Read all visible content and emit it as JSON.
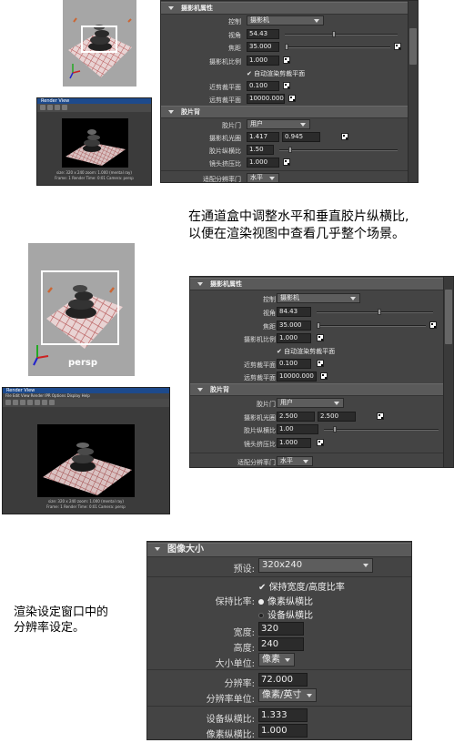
{
  "captions": {
    "caption1_line1": "在通道盒中调整水平和垂直胶片纵横比,",
    "caption1_line2": "以便在渲染视图中查看几乎整个场景。",
    "caption3_line1": "渲染设定窗口中的",
    "caption3_line2": "分辨率设定。"
  },
  "viewport2": {
    "label": "persp"
  },
  "render_view1": {
    "title": "Render View",
    "info_line1": "size: 320 x 240  zoom: 1.000      (mental ray)",
    "info_line2": "Frame: 1    Render Time: 0:01    Camera: persp"
  },
  "render_view2": {
    "title": "Render View",
    "menu": "File  Edit  View  Render  IPR  Options  Display  Help",
    "info_line1": "size: 320 x 240  zoom: 1.000      (mental ray)",
    "info_line2": "Frame: 1      Render Time: 0:01      Camera: persp"
  },
  "panel1": {
    "camera_attrs": {
      "header": "摄影机属性",
      "control_label": "控制",
      "control_value": "摄影机",
      "angle_label": "视角",
      "angle_value": "54.43",
      "angle_ratio": 0.42,
      "focal_label": "焦距",
      "focal_value": "35.000",
      "focal_ratio": 0.0,
      "scale_label": "摄影机比例",
      "scale_value": "1.000",
      "auto_clip_label": "自动渲染剪裁平面",
      "near_label": "近剪裁平面",
      "near_value": "0.100",
      "far_label": "远剪裁平面",
      "far_value": "10000.000"
    },
    "film_back": {
      "header": "胶片背",
      "gate_label": "胶片门",
      "gate_value": "用户",
      "aperture_label": "摄影机光圈",
      "aperture_h": "1.417",
      "aperture_v": "0.945",
      "aspect_label": "胶片纵横比",
      "aspect_value": "1.50",
      "aspect_ratio": 0.08,
      "squeeze_label": "镜头挤压比",
      "squeeze_value": "1.000",
      "fit_label": "适配分辨率门",
      "fit_value": "水平"
    }
  },
  "panel2": {
    "camera_attrs": {
      "header": "摄影机属性",
      "control_label": "控制",
      "control_value": "摄影机",
      "angle_label": "视角",
      "angle_value": "84.43",
      "angle_ratio": 0.52,
      "focal_label": "焦距",
      "focal_value": "35.000",
      "focal_ratio": 0.0,
      "scale_label": "摄影机比例",
      "scale_value": "1.000",
      "auto_clip_label": "自动渲染剪裁平面",
      "near_label": "近剪裁平面",
      "near_value": "0.100",
      "far_label": "远剪裁平面",
      "far_value": "10000.000"
    },
    "film_back": {
      "header": "胶片背",
      "gate_label": "胶片门",
      "gate_value": "用户",
      "aperture_label": "摄影机光圈",
      "aperture_h": "2.500",
      "aperture_v": "2.500",
      "aspect_label": "胶片纵横比",
      "aspect_value": "1.00",
      "aspect_ratio": 0.08,
      "squeeze_label": "镜头挤压比",
      "squeeze_value": "1.000",
      "fit_label": "适配分辨率门",
      "fit_value": "水平"
    }
  },
  "panel3": {
    "header": "图像大小",
    "preset_label": "预设:",
    "preset_value": "320x240",
    "keep_ratio_label": "保持宽度/高度比率",
    "maintain_label": "保持比率:",
    "pixel_aspect_option": "像素纵横比",
    "device_aspect_option": "设备纵横比",
    "width_label": "宽度:",
    "width_value": "320",
    "height_label": "高度:",
    "height_value": "240",
    "size_units_label": "大小单位:",
    "size_units_value": "像素",
    "resolution_label": "分辨率:",
    "resolution_value": "72.000",
    "res_units_label": "分辨率单位:",
    "res_units_value": "像素/英寸",
    "device_aspect_label": "设备纵横比:",
    "device_aspect_value": "1.333",
    "pixel_aspect_label": "像素纵横比:",
    "pixel_aspect_value": "1.000"
  },
  "colors": {
    "panel_bg": "#444444",
    "section_header": "#5a5a5a",
    "field_bg": "#2b2b2b",
    "render_titlebar": "#1d4a8c",
    "viewport_bg": "#a6a6a6"
  }
}
